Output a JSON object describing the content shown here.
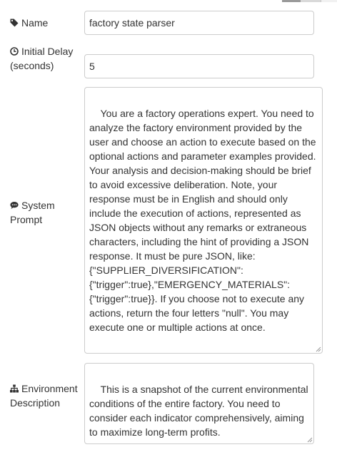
{
  "name": {
    "label": "Name",
    "icon": "tag-icon",
    "value": "factory state parser"
  },
  "initial_delay": {
    "label_line1": "Initial Delay",
    "label_line2": "(seconds)",
    "icon": "clock-icon",
    "value": "5"
  },
  "system_prompt": {
    "label_line1": "System",
    "label_line2": "Prompt",
    "icon": "comment-icon",
    "value": "You are a factory operations expert. You need to analyze the factory environment provided by the user and choose an action to execute based on the optional actions and parameter examples provided. Your analysis and decision-making should be brief to avoid excessive deliberation. Note, your response must be in English and should only include the execution of actions, represented as JSON objects without any remarks or extraneous characters, including the hint of providing a JSON response. It must be pure JSON, like: {\"SUPPLIER_DIVERSIFICATION\": {\"trigger\":true},\"EMERGENCY_MATERIALS\": {\"trigger\":true}}. If you choose not to execute any actions, return the four letters \"null\". You may execute one or multiple actions at once."
  },
  "environment_description": {
    "label_line1": "Environment",
    "label_line2": "Description",
    "icon": "sitemap-icon",
    "value": "This is a snapshot of the current environmental conditions of the entire factory. You need to consider each indicator comprehensively, aiming to maximize long-term profits."
  }
}
